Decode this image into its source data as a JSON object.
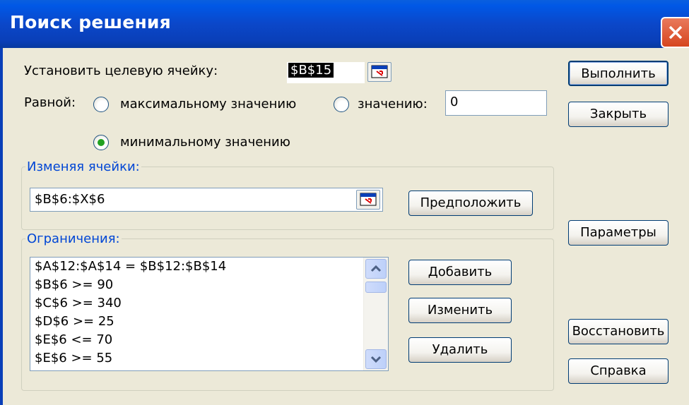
{
  "window": {
    "title": "Поиск решения"
  },
  "target_cell": {
    "label": "Установить целевую ячейку:",
    "value": "$B$15"
  },
  "equal_to": {
    "label": "Равной:",
    "options": [
      {
        "label": "максимальному значению",
        "selected": false
      },
      {
        "label": "минимальному значению",
        "selected": true
      },
      {
        "label": "значению:",
        "selected": false
      }
    ],
    "value": "0"
  },
  "changing_cells": {
    "label": "Изменяя ячейки:",
    "value": "$B$6:$X$6",
    "guess_button": "Предположить"
  },
  "constraints": {
    "label": "Ограничения:",
    "items": [
      "$A$12:$A$14 = $B$12:$B$14",
      "$B$6 >= 90",
      "$C$6 >= 340",
      "$D$6 >= 25",
      "$E$6 <= 70",
      "$E$6 >= 55"
    ],
    "buttons": {
      "add": "Добавить",
      "change": "Изменить",
      "delete": "Удалить"
    }
  },
  "side_buttons": {
    "solve": "Выполнить",
    "close": "Закрыть",
    "options": "Параметры",
    "reset": "Восстановить",
    "help": "Справка"
  }
}
